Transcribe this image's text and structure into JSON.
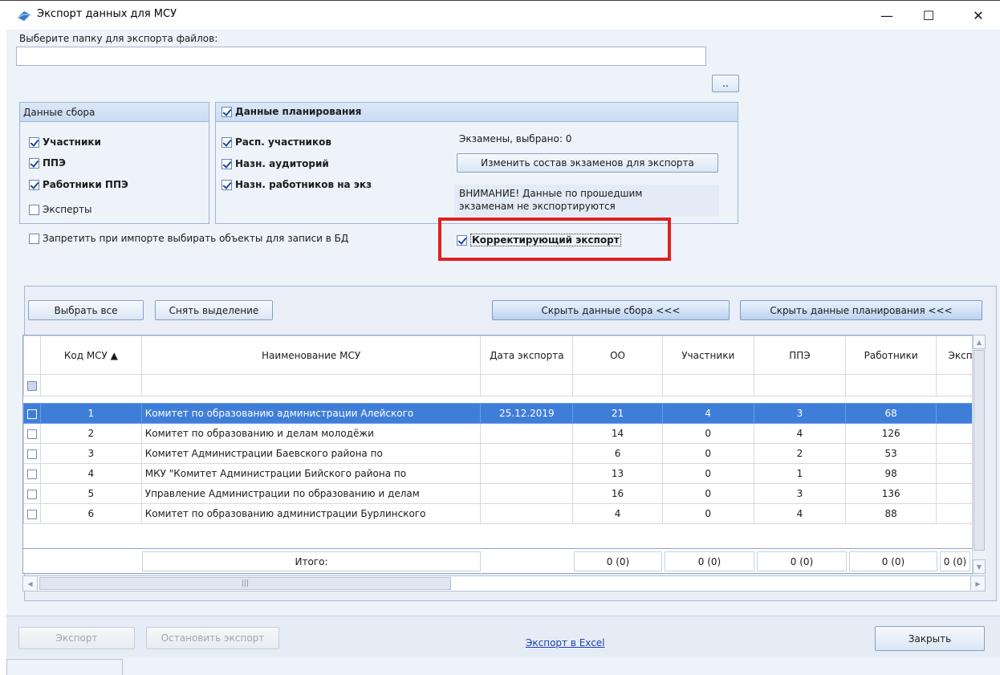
{
  "window": {
    "title": "Экспорт данных для МСУ",
    "minimize": "—",
    "maximize": "☐",
    "close": "✕"
  },
  "folder": {
    "label": "Выберите папку для экспорта файлов:",
    "path_value": "",
    "browse_button": ".."
  },
  "data_collection": {
    "header": "Данные сбора",
    "items": [
      {
        "label": "Участники",
        "checked": true
      },
      {
        "label": "ППЭ",
        "checked": true
      },
      {
        "label": "Работники ППЭ",
        "checked": true
      },
      {
        "label": "Эксперты",
        "checked": false
      }
    ]
  },
  "planning": {
    "header": "Данные планирования",
    "header_checked": true,
    "items": [
      {
        "label": "Расп. участников",
        "checked": true
      },
      {
        "label": "Назн. аудиторий",
        "checked": true
      },
      {
        "label": "Назн. работников на экз",
        "checked": true
      }
    ],
    "exams_selected": "Экзамены, выбрано: 0",
    "change_exams_button": "Изменить состав экзаменов для экспорта",
    "warning_line1": "ВНИМАНИЕ! Данные по прошедшим",
    "warning_line2": "экзаменам не экспортируются"
  },
  "forbid_import_select": {
    "label": "Запретить при импорте выбирать объекты для записи в БД",
    "checked": false
  },
  "corrective_export": {
    "label": "Корректирующий экспорт",
    "checked": true
  },
  "toolbar": {
    "select_all": "Выбрать все",
    "deselect": "Снять выделение",
    "hide_collection": "Скрыть данные сбора <<<",
    "hide_planning": "Скрыть данные планирования <<<"
  },
  "table": {
    "columns": [
      "Код МСУ ▲",
      "Наименование МСУ",
      "Дата экспорта",
      "ОО",
      "Участники",
      "ППЭ",
      "Работники",
      "Эксп"
    ],
    "rows": [
      {
        "code": "1",
        "name": "Комитет по образованию администрации Алейского",
        "date": "25.12.2019",
        "oo": "21",
        "participants": "4",
        "ppe": "3",
        "workers": "68",
        "selected": true
      },
      {
        "code": "2",
        "name": "Комитет по образованию  и делам молодёжи",
        "date": "",
        "oo": "14",
        "participants": "0",
        "ppe": "4",
        "workers": "126",
        "selected": false
      },
      {
        "code": "3",
        "name": "Комитет Администрации Баевского района по",
        "date": "",
        "oo": "6",
        "participants": "0",
        "ppe": "2",
        "workers": "53",
        "selected": false
      },
      {
        "code": "4",
        "name": "МКУ \"Комитет Администрации Бийского района по",
        "date": "",
        "oo": "13",
        "participants": "0",
        "ppe": "1",
        "workers": "98",
        "selected": false
      },
      {
        "code": "5",
        "name": "Управление Администрации по образованию и делам",
        "date": "",
        "oo": "16",
        "participants": "0",
        "ppe": "3",
        "workers": "136",
        "selected": false
      },
      {
        "code": "6",
        "name": "Комитет по образованию администрации Бурлинского",
        "date": "",
        "oo": "4",
        "participants": "0",
        "ppe": "4",
        "workers": "88",
        "selected": false
      }
    ],
    "totals": {
      "label": "Итого:",
      "oo": "0 (0)",
      "participants": "0 (0)",
      "ppe": "0 (0)",
      "workers": "0 (0)",
      "experts": "0 (0)"
    }
  },
  "footer": {
    "export": "Экспорт",
    "stop_export": "Остановить экспорт",
    "excel_link": "Экспорт в Excel",
    "close": "Закрыть"
  }
}
